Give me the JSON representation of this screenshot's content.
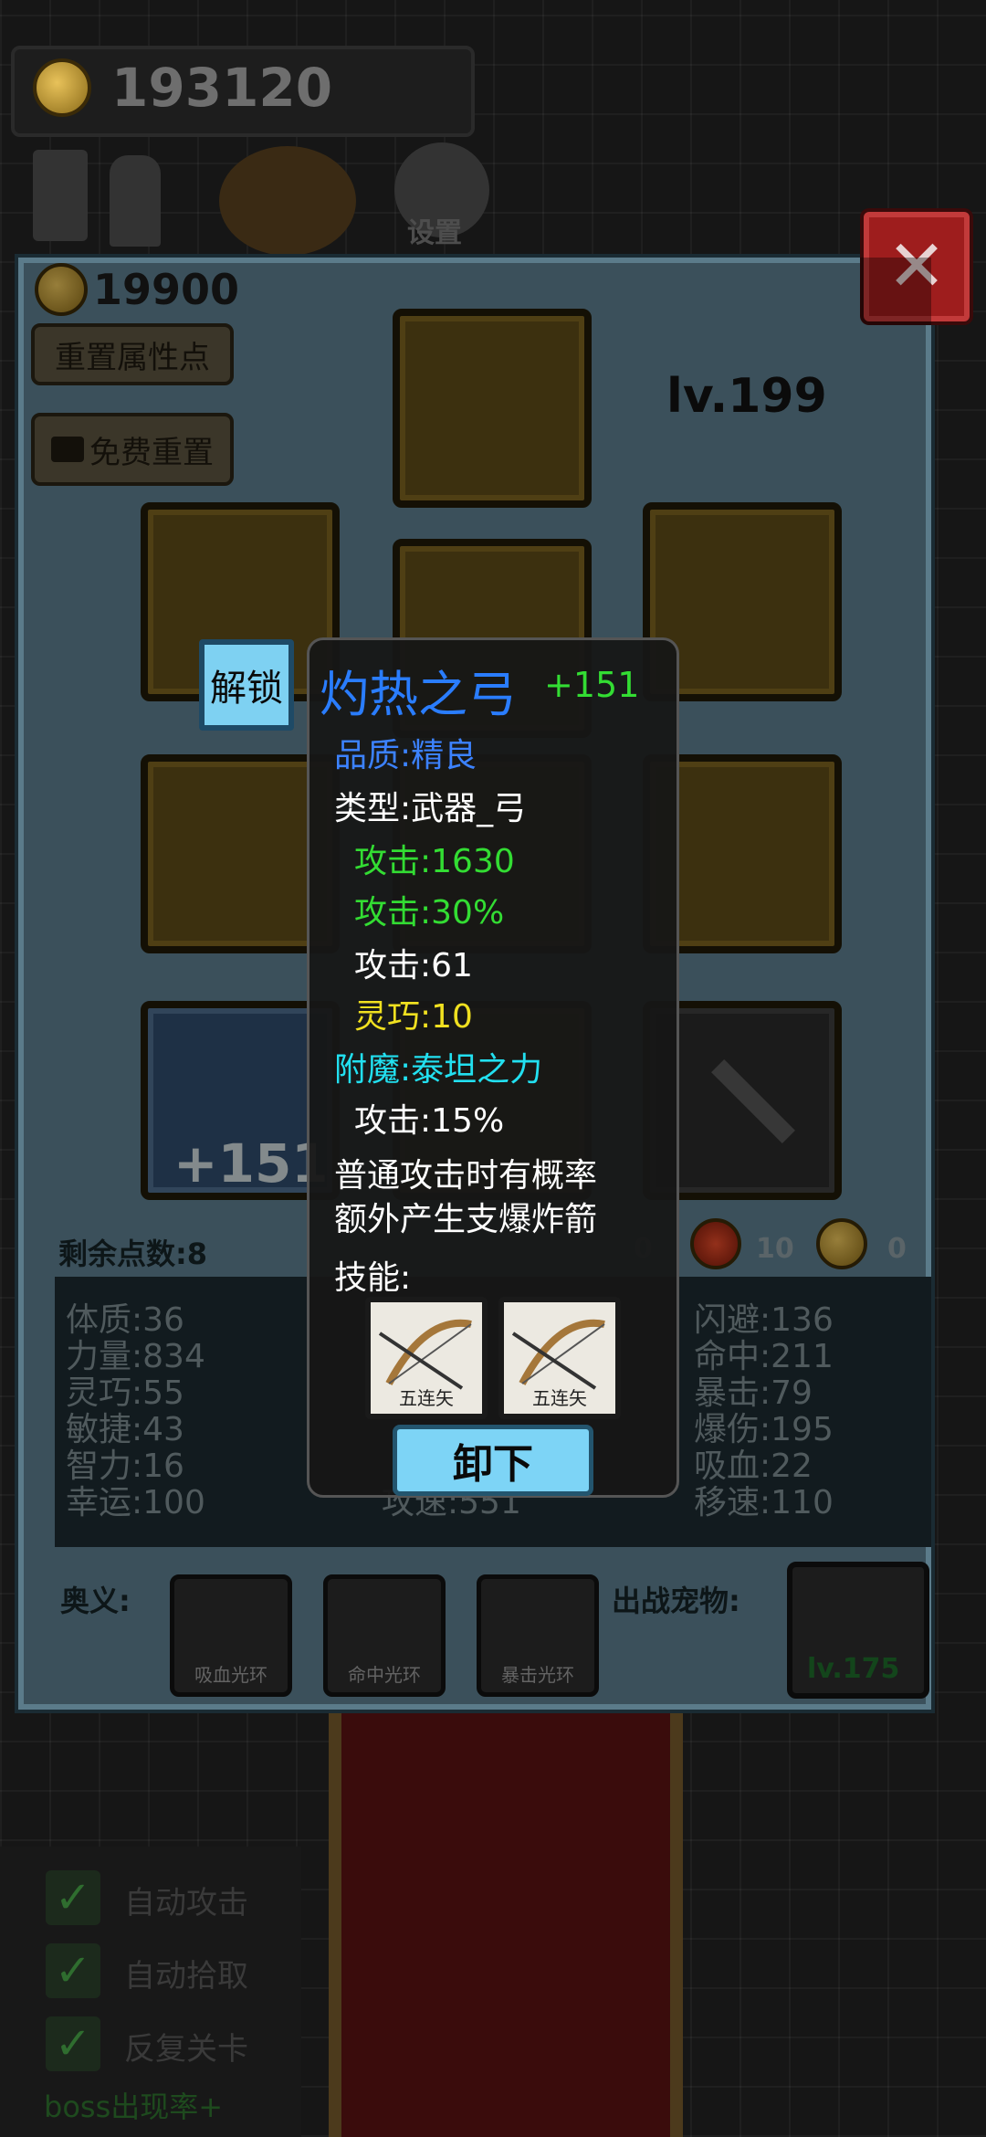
{
  "top": {
    "gold": "193120",
    "settings_label": "设置"
  },
  "panel": {
    "coins": "19900",
    "reset_points_button": "重置属性点",
    "free_reset_button": "免费重置",
    "level": "lv.199",
    "weapon_plus": "+151",
    "remaining_points": "剩余点数:8",
    "counters": [
      "0",
      "10",
      "0"
    ],
    "stats_left": [
      "体质:36",
      "力量:834",
      "灵巧:55",
      "敏捷:43",
      "智力:16",
      "幸运:100"
    ],
    "stats_mid_bottom": "攻速:551",
    "stats_right": [
      "闪避:136",
      "命中:211",
      "暴击:79",
      "爆伤:195",
      "吸血:22",
      "移速:110"
    ],
    "mystery_label": "奥义:",
    "auras": [
      "吸血光环",
      "命中光环",
      "暴击光环"
    ],
    "pet_label": "出战宠物:",
    "pet_level": "lv.175"
  },
  "tooltip": {
    "unlock_button": "解锁",
    "name": "灼热之弓",
    "plus": "+151",
    "quality": "品质:精良",
    "type": "类型:武器_弓",
    "lines": [
      {
        "text": "攻击:1630",
        "color": "#33dd33"
      },
      {
        "text": "攻击:30%",
        "color": "#33dd33"
      },
      {
        "text": "攻击:61",
        "color": "#ffffff"
      },
      {
        "text": "灵巧:10",
        "color": "#f0e020"
      }
    ],
    "enchant": "附魔:泰坦之力",
    "enchant_effect": "攻击:15%",
    "desc1": "普通攻击时有概率",
    "desc2": "额外产生支爆炸箭",
    "skill_label": "技能:",
    "skills": [
      "五连矢",
      "五连矢"
    ],
    "unload_button": "卸下"
  },
  "options": {
    "items": [
      "自动攻击",
      "自动拾取",
      "反复关卡"
    ],
    "boss_text": "boss出现率+"
  },
  "colors": {
    "name_blue": "#2a7dff",
    "quality_blue": "#3c82ff",
    "enchant_cyan": "#22e0f0",
    "green": "#33dd33"
  }
}
